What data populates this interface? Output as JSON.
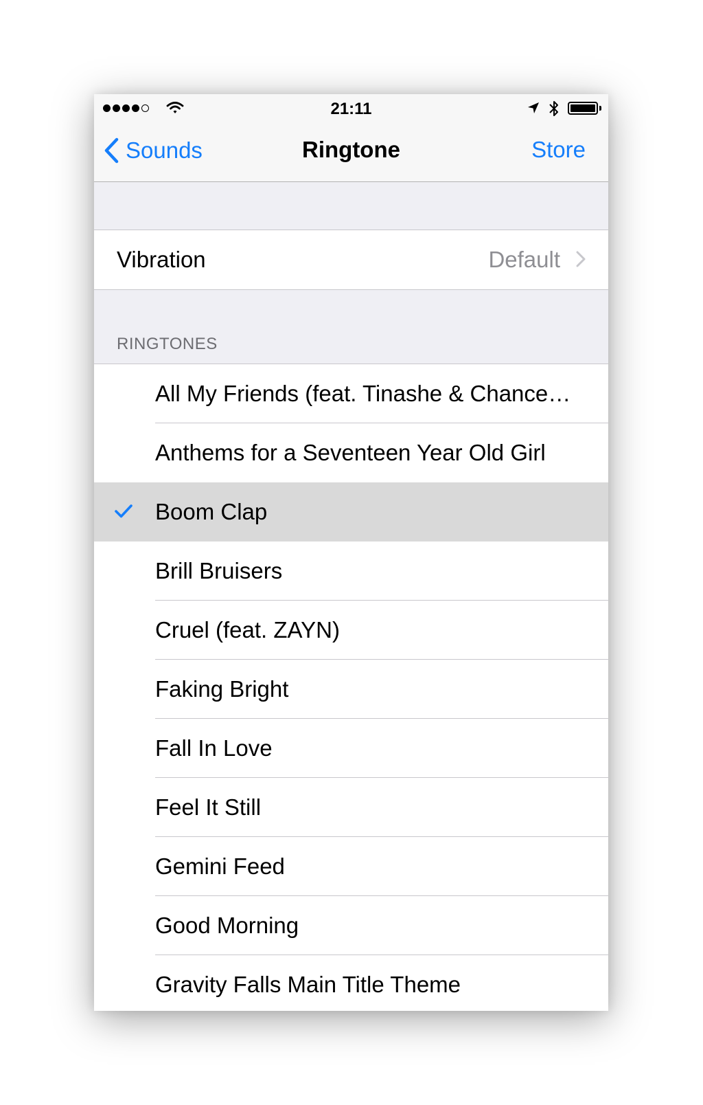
{
  "status_bar": {
    "signal": {
      "bars_filled": 4,
      "bars_total": 5
    },
    "time": "21:11",
    "battery_level": 1.0,
    "icons": [
      "wifi-icon",
      "location-icon",
      "bluetooth-icon",
      "battery-icon"
    ]
  },
  "nav": {
    "back_label": "Sounds",
    "title": "Ringtone",
    "store_label": "Store"
  },
  "vibration": {
    "label": "Vibration",
    "value": "Default"
  },
  "section_header": "RINGTONES",
  "ringtones": [
    {
      "label": "All My Friends (feat. Tinashe & Chance…",
      "selected": false
    },
    {
      "label": "Anthems for a Seventeen Year Old Girl",
      "selected": false
    },
    {
      "label": "Boom Clap",
      "selected": true
    },
    {
      "label": "Brill Bruisers",
      "selected": false
    },
    {
      "label": "Cruel (feat. ZAYN)",
      "selected": false
    },
    {
      "label": "Faking Bright",
      "selected": false
    },
    {
      "label": "Fall In Love",
      "selected": false
    },
    {
      "label": "Feel It Still",
      "selected": false
    },
    {
      "label": "Gemini Feed",
      "selected": false
    },
    {
      "label": "Good Morning",
      "selected": false
    },
    {
      "label": "Gravity Falls Main Title Theme",
      "selected": false
    }
  ],
  "colors": {
    "accent": "#157efb",
    "background": "#efeff4",
    "selected_row": "#d9d9d9",
    "secondary_text": "#8e8e93"
  }
}
